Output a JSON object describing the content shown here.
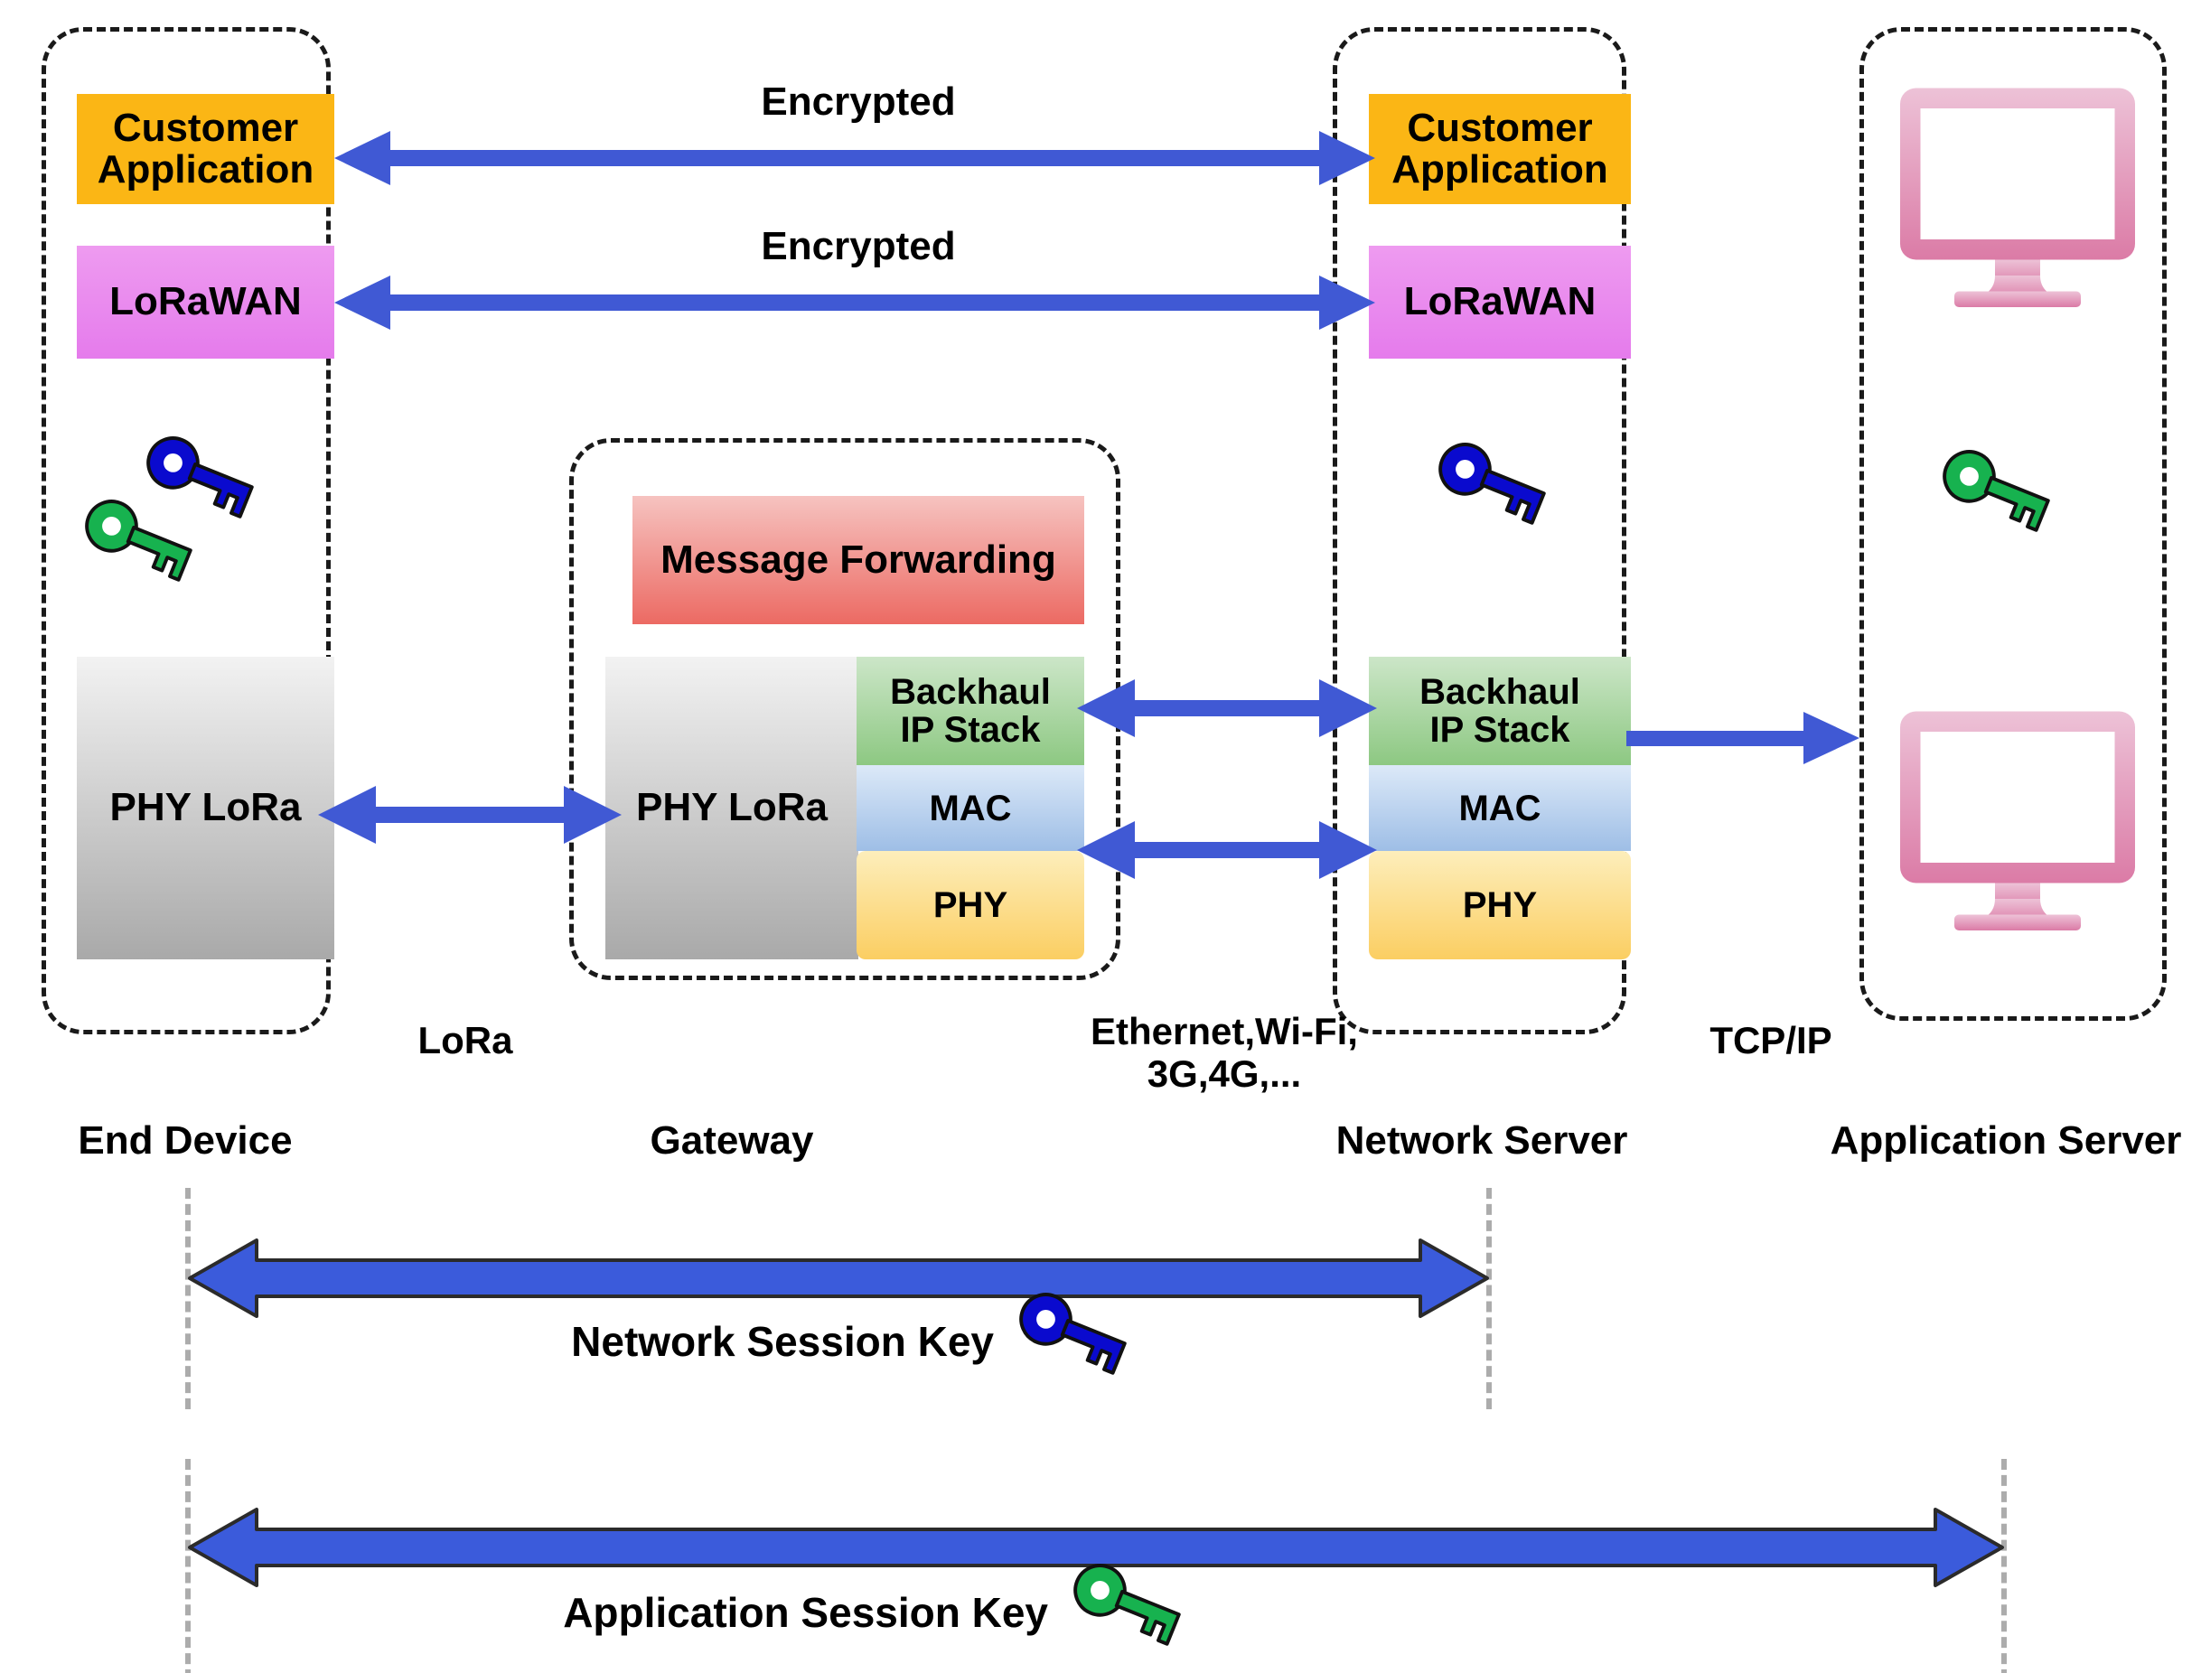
{
  "diagram": {
    "title": "LoRaWAN end-to-end security architecture",
    "colors": {
      "arrow_blue": "#4059D4",
      "arrow_blue_thick": "#3B5BDB",
      "key_blue": "#0A0ACE",
      "key_green": "#17B24F",
      "customer_app": "#FBB615",
      "lorawan": "#E57BEC",
      "message_forwarding": "#EC6A63",
      "phy_lora": "#A9A9A9",
      "backhaul": "#8DC882",
      "mac": "#9EBEE6",
      "phy": "#FBCE62",
      "monitor_pink": "#DD7FA8",
      "dash_black": "#1A1A1A",
      "lifeline_gray": "#ACACAC"
    },
    "columns": [
      {
        "id": "end-device",
        "label": "End Device"
      },
      {
        "id": "gateway",
        "label": "Gateway"
      },
      {
        "id": "network-server",
        "label": "Network Server"
      },
      {
        "id": "application-server",
        "label": "Application Server"
      }
    ],
    "end_device": {
      "layers": [
        {
          "id": "customer-application",
          "label": "Customer\nApplication"
        },
        {
          "id": "lorawan",
          "label": "LoRaWAN"
        },
        {
          "id": "phy-lora",
          "label": "PHY LoRa"
        }
      ],
      "keys": [
        {
          "id": "network-session-key",
          "color": "blue"
        },
        {
          "id": "application-session-key",
          "color": "green"
        }
      ]
    },
    "gateway": {
      "layers": [
        {
          "id": "message-forwarding",
          "label": "Message Forwarding"
        },
        {
          "id": "phy-lora",
          "label": "PHY LoRa"
        },
        {
          "id": "backhaul-ip-stack",
          "label": "Backhaul\nIP Stack"
        },
        {
          "id": "mac",
          "label": "MAC"
        },
        {
          "id": "phy",
          "label": "PHY"
        }
      ]
    },
    "network_server": {
      "layers": [
        {
          "id": "customer-application",
          "label": "Customer\nApplication"
        },
        {
          "id": "lorawan",
          "label": "LoRaWAN"
        },
        {
          "id": "backhaul-ip-stack",
          "label": "Backhaul\nIP Stack"
        },
        {
          "id": "mac",
          "label": "MAC"
        },
        {
          "id": "phy",
          "label": "PHY"
        }
      ],
      "keys": [
        {
          "id": "network-session-key",
          "color": "blue"
        }
      ]
    },
    "application_server": {
      "monitors": [
        {
          "id": "monitor-top"
        },
        {
          "id": "monitor-bottom"
        }
      ],
      "keys": [
        {
          "id": "application-session-key",
          "color": "green"
        }
      ]
    },
    "link_labels": {
      "encrypted_application": "Encrypted",
      "encrypted_lorawan": "Encrypted",
      "lora": "LoRa",
      "backhaul": "Ethernet,Wi-Fi,\n3G,4G,...",
      "tcpip": "TCP/IP"
    },
    "session_scopes": [
      {
        "id": "network-session-key",
        "label": "Network Session Key",
        "key_color": "blue",
        "from": "End Device",
        "to": "Network Server"
      },
      {
        "id": "application-session-key",
        "label": "Application Session Key",
        "key_color": "green",
        "from": "End Device",
        "to": "Application Server"
      }
    ]
  }
}
